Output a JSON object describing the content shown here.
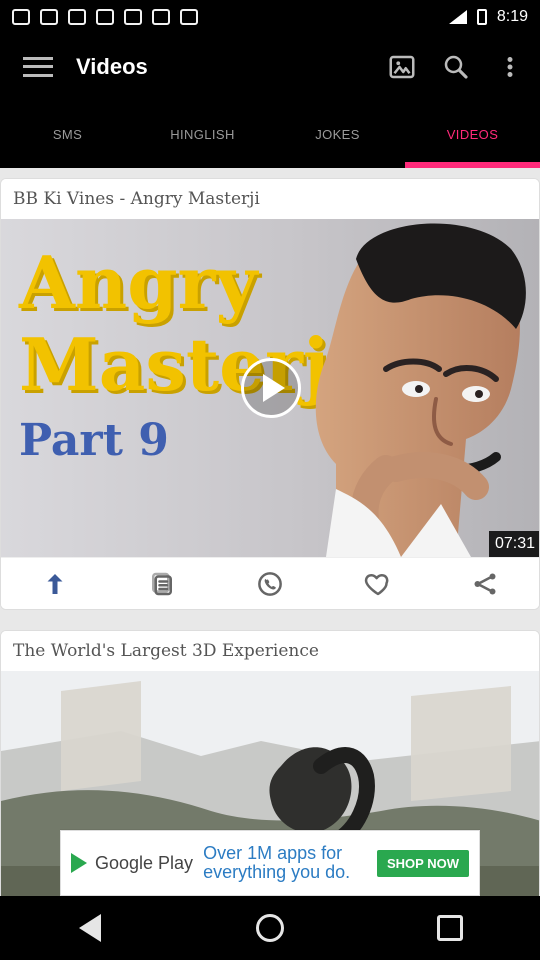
{
  "status_bar": {
    "time": "8:19"
  },
  "app_bar": {
    "title": "Videos"
  },
  "tabs": [
    {
      "label": "SMS"
    },
    {
      "label": "HINGLISH"
    },
    {
      "label": "JOKES"
    },
    {
      "label": "VIDEOS"
    }
  ],
  "feed": {
    "items": [
      {
        "title": "BB Ki Vines - Angry Masterji",
        "thumbnail_text": {
          "line1": "Angry",
          "line2": "Masterji",
          "line3": "Part 9"
        },
        "duration": "07:31"
      },
      {
        "title": "The World's Largest 3D Experience"
      }
    ]
  },
  "ad": {
    "brand": "Google Play",
    "text_line1": "Over 1M apps for",
    "text_line2": "everything you do.",
    "cta": "SHOP NOW"
  },
  "icons": {
    "menu": "menu-icon",
    "gallery": "image-icon",
    "search": "search-icon",
    "overflow": "more-vert-icon",
    "facebook": "facebook-icon",
    "copy": "copy-icon",
    "whatsapp": "whatsapp-icon",
    "like": "heart-icon",
    "share": "share-icon",
    "play": "play-icon",
    "nav_back": "back-icon",
    "nav_home": "home-icon",
    "nav_recent": "recent-apps-icon"
  },
  "colors": {
    "accent": "#ff2a7a",
    "background": "#000000",
    "tab_inactive": "#9a9a9a",
    "card_bg": "#ffffff",
    "feed_bg": "#e8e8e8",
    "google_play_green": "#2aa84f"
  }
}
